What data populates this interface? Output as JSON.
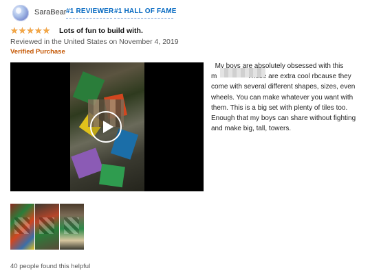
{
  "reviewer": {
    "name": "SaraBear",
    "badges": [
      "#1 REVIEWER",
      "#1 HALL OF FAME"
    ]
  },
  "review": {
    "rating": 5,
    "stars": "★★★★★",
    "title": "Lots of fun to build with.",
    "reviewed_line": "Reviewed in the United States on November 4, 2019",
    "verified": "Verified Purchase",
    "body": "  My boys are absolutely obsessed with this\nm                These are extra cool rbcause they\ncome with several different shapes, sizes, even\nwheels. You can make whatever you want with\nthem. This is a big set with plenty of tiles too.\nEnough that my boys can share without fighting\nand make big, tall, towers.",
    "helpful": "40 people found this helpful"
  },
  "colors": {
    "badge": "#0066c0",
    "star": "#f3a847",
    "verified": "#c45500"
  },
  "icons": {
    "play": "play-icon"
  }
}
